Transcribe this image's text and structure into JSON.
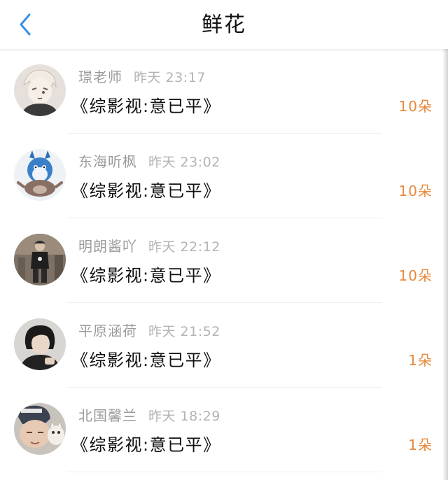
{
  "header": {
    "title": "鲜花"
  },
  "records": [
    {
      "name": "璟老师",
      "time": "昨天 23:17",
      "book": "《综影视:意已平》",
      "count": "10朵"
    },
    {
      "name": "东海听枫",
      "time": "昨天 23:02",
      "book": "《综影视:意已平》",
      "count": "10朵"
    },
    {
      "name": "明朗酱吖",
      "time": "昨天 22:12",
      "book": "《综影视:意已平》",
      "count": "10朵"
    },
    {
      "name": "平原涵荷",
      "time": "昨天 21:52",
      "book": "《综影视:意已平》",
      "count": "1朵"
    },
    {
      "name": "北国馨兰",
      "time": "昨天 18:29",
      "book": "《综影视:意已平》",
      "count": "1朵"
    }
  ],
  "colors": {
    "accent_back": "#3a8ee6",
    "count_orange": "#e8893b",
    "title_text": "#111111",
    "secondary_text": "#9b9b9b"
  },
  "icons": {
    "back": "chevron-left-icon"
  }
}
